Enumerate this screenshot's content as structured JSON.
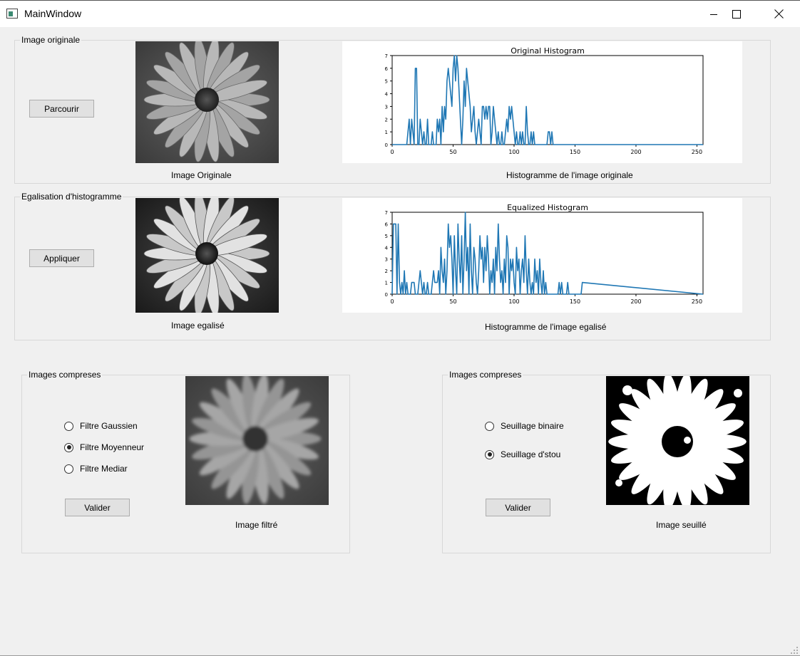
{
  "window": {
    "title": "MainWindow",
    "icons": {
      "app": "app-window-icon",
      "minimize": "minimize-icon",
      "maximize": "maximize-icon",
      "close": "close-icon"
    }
  },
  "original_group": {
    "title": "Image originale",
    "button_label": "Parcourir",
    "image_caption": "Image Originale",
    "histogram_caption": "Histogramme de l'image originale",
    "image_name": "daisy-grayscale-image"
  },
  "equalize_group": {
    "title": "Egalisation d'histogramme",
    "button_label": "Appliquer",
    "image_caption": "Image egalisé",
    "histogram_caption": "Histogramme de l'image egalisé",
    "image_name": "daisy-equalized-image"
  },
  "filter_group": {
    "title": "Images compreses",
    "options": [
      {
        "label": "Filtre Gaussien",
        "checked": false
      },
      {
        "label": "Filtre Moyenneur",
        "checked": true
      },
      {
        "label": "Filtre Mediar",
        "checked": false
      }
    ],
    "button_label": "Valider",
    "image_caption": "Image filtré"
  },
  "threshold_group": {
    "title": "Images compreses",
    "options": [
      {
        "label": "Seuillage binaire",
        "checked": false
      },
      {
        "label": "Seuillage d'stou",
        "checked": true
      }
    ],
    "button_label": "Valider",
    "image_caption": "Image seuillé"
  },
  "chart_data": [
    {
      "type": "line",
      "title": "Original Histogram",
      "xlim": [
        0,
        255
      ],
      "ylim": [
        0,
        7
      ],
      "xticks": [
        "0",
        "50",
        "100",
        "150",
        "200",
        "250"
      ],
      "yticks": [
        "0",
        "1",
        "2",
        "3",
        "4",
        "5",
        "6",
        "7"
      ],
      "color": "#1f77b4",
      "x": [
        0,
        12,
        13,
        14,
        15,
        16,
        17,
        18,
        19,
        20,
        21,
        22,
        23,
        24,
        25,
        26,
        27,
        28,
        29,
        30,
        31,
        32,
        33,
        34,
        35,
        36,
        37,
        38,
        39,
        40,
        41,
        42,
        43,
        44,
        45,
        46,
        47,
        48,
        49,
        50,
        51,
        52,
        53,
        54,
        55,
        56,
        57,
        58,
        59,
        60,
        61,
        62,
        63,
        64,
        65,
        66,
        67,
        68,
        69,
        70,
        71,
        72,
        73,
        74,
        75,
        76,
        77,
        78,
        79,
        80,
        81,
        82,
        83,
        84,
        85,
        86,
        87,
        88,
        89,
        90,
        91,
        92,
        93,
        94,
        95,
        96,
        97,
        98,
        99,
        100,
        101,
        102,
        103,
        104,
        105,
        106,
        107,
        108,
        109,
        110,
        111,
        112,
        113,
        114,
        115,
        116,
        117,
        118,
        119,
        120,
        121,
        122,
        123,
        124,
        125,
        126,
        127,
        128,
        129,
        130,
        131,
        132,
        133,
        134,
        135,
        136,
        137,
        138,
        139,
        140,
        141,
        142,
        143,
        144,
        145,
        146,
        255
      ],
      "y": [
        0,
        0,
        1,
        2,
        0,
        2,
        1,
        0,
        6,
        6,
        0,
        0,
        2,
        1,
        0,
        1,
        0,
        0,
        2,
        0,
        0,
        0,
        1,
        0,
        0,
        0,
        2,
        1,
        2,
        0,
        3,
        1,
        3,
        2,
        5,
        6,
        5,
        4,
        3,
        6,
        7,
        5,
        7,
        6,
        4,
        2,
        0,
        2,
        5,
        3,
        6,
        5,
        4,
        3,
        1,
        2,
        3,
        1,
        0,
        1,
        2,
        1,
        0,
        3,
        3,
        2,
        3,
        2,
        3,
        3,
        0,
        1,
        3,
        2,
        1,
        0,
        1,
        0,
        0,
        1,
        0,
        0,
        1,
        2,
        1,
        3,
        2,
        3,
        2,
        1,
        0,
        1,
        0,
        0,
        1,
        0,
        1,
        0,
        0,
        3,
        1,
        0,
        0,
        1,
        0,
        1,
        0,
        0,
        0,
        0,
        0,
        0,
        0,
        0,
        0,
        0,
        0,
        1,
        1,
        0,
        1,
        0,
        0,
        0,
        0,
        0,
        0,
        0,
        0,
        0,
        0,
        0,
        0,
        0,
        0,
        0,
        0
      ]
    },
    {
      "type": "line",
      "title": "Equalized Histogram",
      "xlim": [
        0,
        255
      ],
      "ylim": [
        0,
        7
      ],
      "xticks": [
        "0",
        "50",
        "100",
        "150",
        "200",
        "250"
      ],
      "yticks": [
        "0",
        "1",
        "2",
        "3",
        "4",
        "5",
        "6",
        "7"
      ],
      "color": "#1f77b4",
      "x": [
        0,
        1,
        2,
        3,
        4,
        5,
        6,
        7,
        8,
        9,
        10,
        11,
        12,
        13,
        14,
        15,
        16,
        17,
        18,
        19,
        20,
        21,
        22,
        23,
        24,
        25,
        26,
        27,
        28,
        29,
        30,
        31,
        32,
        33,
        34,
        35,
        36,
        37,
        38,
        39,
        40,
        41,
        42,
        43,
        44,
        45,
        46,
        47,
        48,
        49,
        50,
        51,
        52,
        53,
        54,
        55,
        56,
        57,
        58,
        59,
        60,
        61,
        62,
        63,
        64,
        65,
        66,
        67,
        68,
        69,
        70,
        71,
        72,
        73,
        74,
        75,
        76,
        77,
        78,
        79,
        80,
        81,
        82,
        83,
        84,
        85,
        86,
        87,
        88,
        89,
        90,
        91,
        92,
        93,
        94,
        95,
        96,
        97,
        98,
        99,
        100,
        101,
        102,
        103,
        104,
        105,
        106,
        107,
        108,
        109,
        110,
        111,
        112,
        113,
        114,
        115,
        116,
        117,
        118,
        119,
        120,
        121,
        122,
        123,
        124,
        125,
        126,
        127,
        128,
        129,
        130,
        131,
        132,
        133,
        134,
        135,
        136,
        137,
        138,
        139,
        140,
        141,
        142,
        143,
        144,
        145,
        146,
        147,
        148,
        149,
        150,
        151,
        152,
        153,
        154,
        155,
        156,
        255
      ],
      "y": [
        0,
        6,
        6,
        6,
        0,
        6,
        1,
        0,
        1,
        0,
        2,
        0,
        1,
        0,
        0,
        0,
        1,
        1,
        1,
        0,
        0,
        0,
        1,
        2,
        1,
        0,
        1,
        0,
        0,
        1,
        0,
        0,
        0,
        1,
        2,
        1,
        1,
        1,
        2,
        0,
        4,
        2,
        1,
        3,
        0,
        2,
        6,
        4,
        5,
        3,
        0,
        5,
        2,
        0,
        6,
        3,
        1,
        5,
        0,
        3,
        7,
        2,
        4,
        0,
        6,
        2,
        0,
        4,
        3,
        1,
        0,
        2,
        5,
        3,
        4,
        1,
        4,
        2,
        5,
        3,
        0,
        2,
        1,
        3,
        0,
        4,
        2,
        6,
        3,
        1,
        2,
        0,
        3,
        1,
        5,
        4,
        0,
        3,
        2,
        3,
        1,
        0,
        4,
        2,
        3,
        0,
        2,
        3,
        1,
        5,
        2,
        0,
        3,
        1,
        0,
        1,
        0,
        3,
        1,
        2,
        0,
        3,
        1,
        0,
        2,
        0,
        1,
        0,
        0,
        0,
        0,
        0,
        0,
        0,
        0,
        0,
        0,
        1,
        0,
        1,
        0,
        0,
        0,
        0,
        1,
        0,
        0,
        0,
        0,
        0,
        0,
        0,
        0,
        0,
        0,
        0,
        1,
        0,
        0
      ]
    }
  ]
}
